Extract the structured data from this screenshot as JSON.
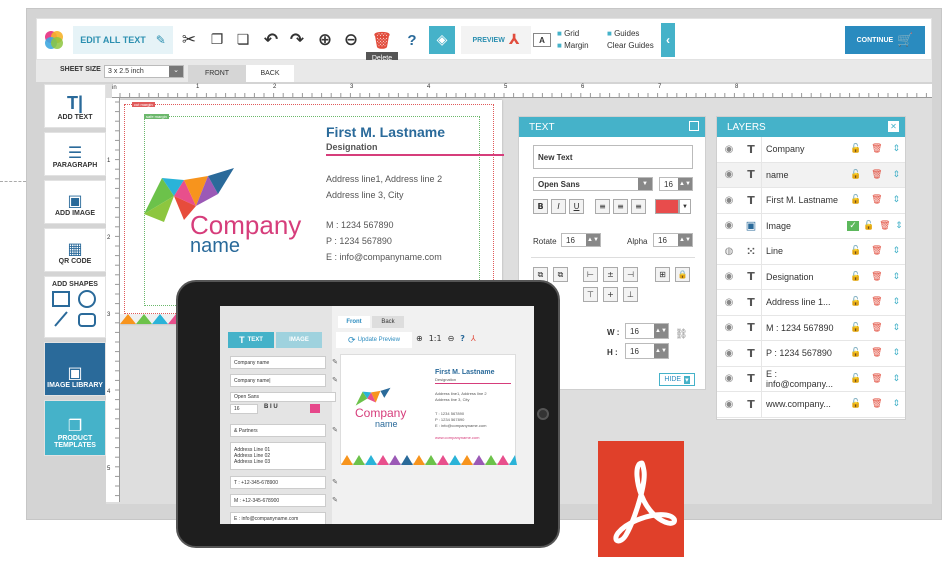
{
  "toolbar": {
    "edit_all_text": "EDIT ALL TEXT",
    "preview": "PREVIEW",
    "grid": "Grid",
    "guides": "Guides",
    "margin": "Margin",
    "clear_guides": "Clear Guides",
    "continue": "CONTINUE",
    "delete_tooltip": "Delete"
  },
  "sheetbar": {
    "label": "SHEET SIZE",
    "size": "3 x 2.5 inch",
    "front": "FRONT",
    "back": "BACK"
  },
  "sidebar": [
    {
      "label": "ADD TEXT"
    },
    {
      "label": "PARAGRAPH"
    },
    {
      "label": "ADD IMAGE"
    },
    {
      "label": "QR CODE"
    },
    {
      "label": "ADD SHAPES"
    },
    {
      "label": "IMAGE LIBRARY"
    },
    {
      "label": "PRODUCT TEMPLATES"
    }
  ],
  "ruler": {
    "unit": "in",
    "ticks": [
      "1",
      "2",
      "3",
      "4",
      "5",
      "6",
      "7",
      "8"
    ],
    "vticks": [
      "1",
      "2",
      "3",
      "4",
      "5"
    ]
  },
  "card": {
    "cut_margin": "cut margin",
    "safe_margin": "safe margin",
    "name": "First M. Lastname",
    "designation": "Designation",
    "addr1": "Address line1, Address line 2",
    "addr2": "Address line 3, City",
    "m": "M : 1234 567890",
    "p": "P : 1234 567890",
    "e": "E :  info@companyname.com",
    "company": "Company",
    "company2": "name"
  },
  "text_panel": {
    "title": "TEXT",
    "value": "New Text",
    "font": "Open Sans",
    "size": "16",
    "rotate_label": "Rotate",
    "rotate": "16",
    "alpha_label": "Alpha",
    "alpha": "16",
    "w_label": "W :",
    "w": "16",
    "h_label": "H :",
    "h": "16",
    "hide": "HIDE",
    "color": "#e84c4c"
  },
  "layers_panel": {
    "title": "LAYERS",
    "items": [
      {
        "name": "Company",
        "type": "T"
      },
      {
        "name": "name",
        "type": "T"
      },
      {
        "name": "First M. Lastname",
        "type": "T"
      },
      {
        "name": "Image",
        "type": "img"
      },
      {
        "name": "Line",
        "type": "line"
      },
      {
        "name": "Designation",
        "type": "T"
      },
      {
        "name": "Address line 1...",
        "type": "T"
      },
      {
        "name": "M : 1234 567890",
        "type": "T"
      },
      {
        "name": "P : 1234 567890",
        "type": "T"
      },
      {
        "name": "E : info@company...",
        "type": "T"
      },
      {
        "name": "www.company...",
        "type": "T"
      }
    ]
  },
  "tablet": {
    "text_tab": "TEXT",
    "image_tab": "IMAGE",
    "front": "Front",
    "back": "Back",
    "update": "Update Preview",
    "fields": [
      "Company name",
      "Company name|",
      "Open Sans",
      "& Partners",
      "Address Line 01",
      "Address Line 02",
      "Address Line 03",
      "T : +12-345-678900",
      "M : +12-345-678900",
      "E : info@companyname.com"
    ],
    "size": "16",
    "card_name": "First M. Lastname",
    "card_desig": "Designation",
    "card_addr": [
      "Address line1, Address line 2",
      "Address line 3, City"
    ],
    "card_t": "T : 1234 567890",
    "card_p": "P : 1234 567890",
    "card_e": "E : info@companyname.com",
    "card_web": "www.companyname.com",
    "company": "Company",
    "company2": "name"
  }
}
